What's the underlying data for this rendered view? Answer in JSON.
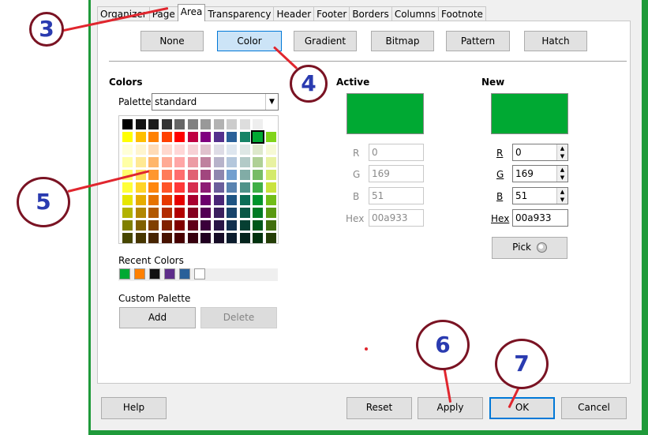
{
  "tabs": [
    "Organizer",
    "Page",
    "Area",
    "Transparency",
    "Header",
    "Footer",
    "Borders",
    "Columns",
    "Footnote"
  ],
  "active_tab": "Area",
  "fill_types": [
    "None",
    "Color",
    "Gradient",
    "Bitmap",
    "Pattern",
    "Hatch"
  ],
  "selected_fill": "Color",
  "colors_section": {
    "title": "Colors",
    "palette_label": "Palette:",
    "palette_value": "standard",
    "recent_label": "Recent Colors",
    "recent_colors": [
      "#00a933",
      "#ff8000",
      "#111111",
      "#5e2d8a",
      "#2a6099",
      "#ffffff"
    ],
    "custom_label": "Custom Palette",
    "add_label": "Add",
    "delete_label": "Delete",
    "palette_rows": [
      [
        "#000000",
        "#111111",
        "#1c1c1c",
        "#333333",
        "#666666",
        "#808080",
        "#999999",
        "#b2b2b2",
        "#cccccc",
        "#dddddd",
        "#eeeeee",
        "#ffffff"
      ],
      [
        "#ffff00",
        "#ffbf00",
        "#ff8000",
        "#ff4000",
        "#ff0000",
        "#bf0041",
        "#800080",
        "#55308d",
        "#2a6099",
        "#158466",
        "#00a933",
        "#81d41a"
      ],
      [
        "#ffffd7",
        "#fff5ce",
        "#ffdbb6",
        "#ffd8ce",
        "#ffd7d7",
        "#f7d1d5",
        "#e0c2cd",
        "#dedce6",
        "#dee6ef",
        "#dee7e5",
        "#dde8cb",
        "#f6f9d4"
      ],
      [
        "#ffffa6",
        "#ffe994",
        "#ffb66c",
        "#ffaa95",
        "#ffa6a6",
        "#ec9ba4",
        "#bf819e",
        "#b7b3ca",
        "#b4c7dc",
        "#b3cac7",
        "#afd095",
        "#e8f2a1"
      ],
      [
        "#ffff6d",
        "#ffde59",
        "#ff972f",
        "#ff7b59",
        "#ff6d6d",
        "#e16173",
        "#a1467e",
        "#8e86ae",
        "#729fcf",
        "#81aca6",
        "#77bc65",
        "#d4ea6b"
      ],
      [
        "#ffff38",
        "#ffd428",
        "#ff860d",
        "#ff5429",
        "#ff3838",
        "#d62e4e",
        "#8d1d75",
        "#6b5e9b",
        "#5983b0",
        "#50938a",
        "#3faf46",
        "#c9e33e"
      ],
      [
        "#e6e600",
        "#e6ac00",
        "#e67300",
        "#e63900",
        "#e60000",
        "#a8002e",
        "#6b006b",
        "#4a2677",
        "#1e5583",
        "#0b6d56",
        "#00942b",
        "#71bd18"
      ],
      [
        "#b2b200",
        "#b28600",
        "#b25900",
        "#b22c00",
        "#b20000",
        "#84001f",
        "#530053",
        "#3b1f5e",
        "#18446b",
        "#0a5846",
        "#007a23",
        "#5a9912"
      ],
      [
        "#808000",
        "#806000",
        "#804000",
        "#802000",
        "#800000",
        "#600017",
        "#3a003a",
        "#2a1646",
        "#12314f",
        "#063f32",
        "#005719",
        "#416e0d"
      ],
      [
        "#474700",
        "#473600",
        "#472400",
        "#471200",
        "#470000",
        "#36000e",
        "#210021",
        "#170c27",
        "#0b1c2d",
        "#04241d",
        "#00320e",
        "#253e07"
      ]
    ]
  },
  "active": {
    "title": "Active",
    "color": "#00a933",
    "r_label": "R",
    "r": "0",
    "g_label": "G",
    "g": "169",
    "b_label": "B",
    "b": "51",
    "hex_label": "Hex",
    "hex": "00a933"
  },
  "new": {
    "title": "New",
    "color": "#00a933",
    "r_label": "R",
    "r": "0",
    "g_label": "G",
    "g": "169",
    "b_label": "B",
    "b": "51",
    "hex_label": "Hex",
    "hex": "00a933",
    "pick_label": "Pick"
  },
  "footer": {
    "help": "Help",
    "reset": "Reset",
    "apply": "Apply",
    "ok": "OK",
    "cancel": "Cancel"
  },
  "callouts": [
    "3",
    "4",
    "5",
    "6",
    "7"
  ],
  "colors": {
    "accent": "#0078d7",
    "selected_fill": "#cce4f7",
    "callout_ring": "#7a1323",
    "callout_text": "#2a3bb0",
    "arrow": "#e0262e",
    "window_edge": "#1f9a3a"
  }
}
